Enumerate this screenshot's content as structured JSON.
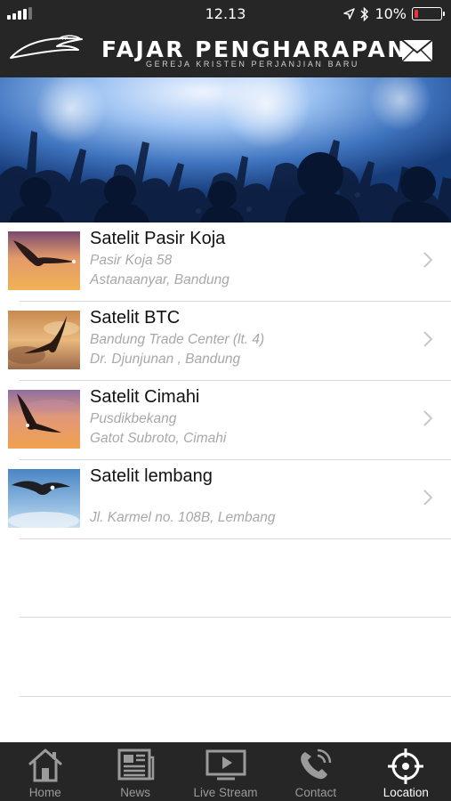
{
  "status_bar": {
    "time": "12.13",
    "battery": "10%",
    "battery_level": 0.1
  },
  "header": {
    "title": "FAJAR PENGHARAPAN",
    "subtitle": "GEREJA KRISTEN PERJANJIAN BARU",
    "mail_icon": "mail-icon"
  },
  "locations": [
    {
      "name": "Satelit Pasir Koja",
      "line1": "Pasir Koja 58",
      "line2": "Astanaanyar, Bandung"
    },
    {
      "name": "Satelit BTC",
      "line1": "Bandung Trade Center (lt. 4)",
      "line2": "Dr. Djunjunan , Bandung"
    },
    {
      "name": "Satelit Cimahi",
      "line1": "Pusdikbekang",
      "line2": "Gatot Subroto, Cimahi"
    },
    {
      "name": "Satelit lembang",
      "line1": "",
      "line2": "Jl. Karmel no. 108B, Lembang"
    }
  ],
  "tabs": [
    {
      "label": "Home",
      "icon": "home-icon"
    },
    {
      "label": "News",
      "icon": "newspaper-icon"
    },
    {
      "label": "Live Stream",
      "icon": "play-screen-icon"
    },
    {
      "label": "Contact",
      "icon": "phone-icon"
    },
    {
      "label": "Location",
      "icon": "crosshair-icon",
      "active": true
    }
  ],
  "colors": {
    "bar_background": "#262626",
    "tab_inactive": "#9b9b9b",
    "tab_active": "#ffffff",
    "battery_low": "#e8353d",
    "secondary_text": "#a8a8a8"
  }
}
